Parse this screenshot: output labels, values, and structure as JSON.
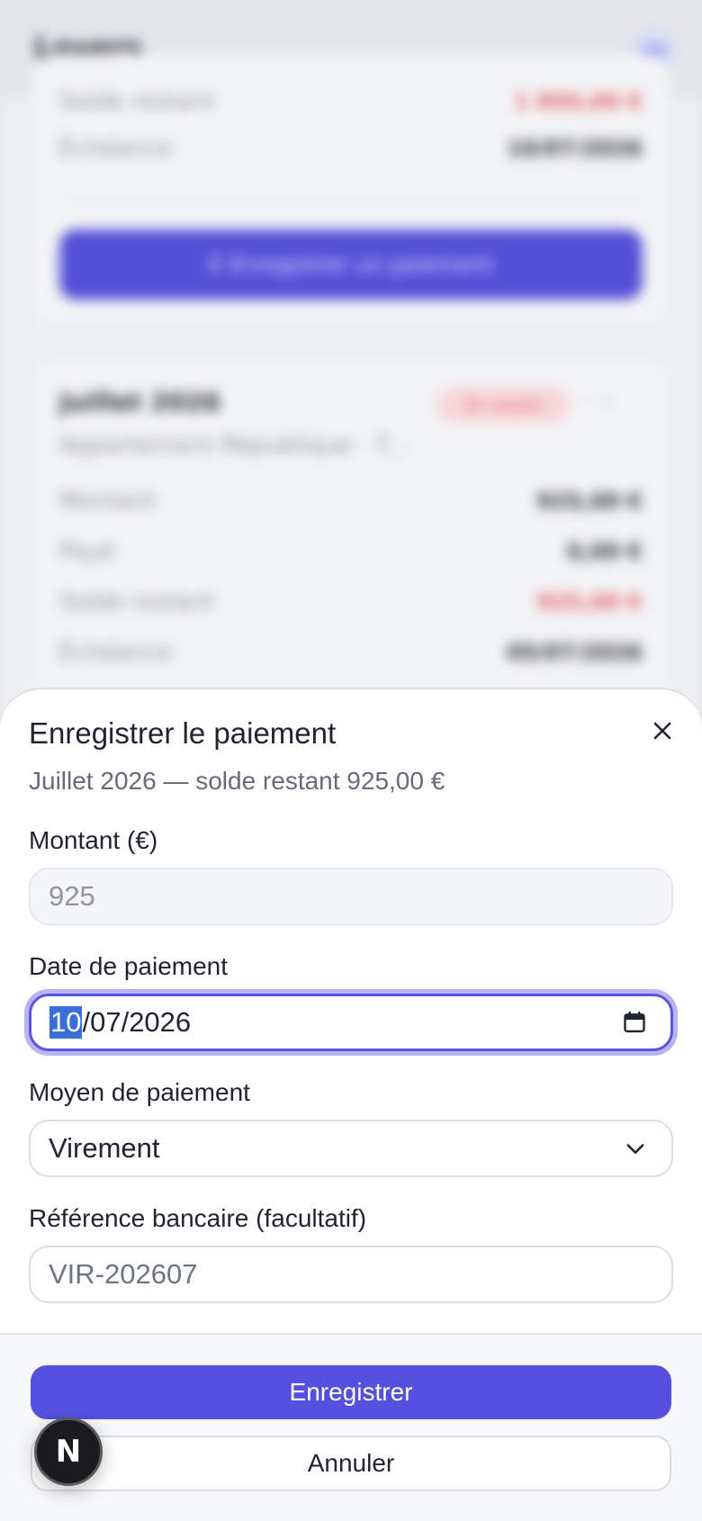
{
  "background": {
    "header_title": "Loyers",
    "avatar_initials": "MD",
    "card1": {
      "rows": [
        {
          "label": "Solde restant",
          "value": "1 850,00 €"
        },
        {
          "label": "Échéance",
          "value": "10/07/2026"
        }
      ],
      "button_label": "€  Enregistrer un paiement"
    },
    "card2": {
      "title": "Juillet 2026",
      "subtitle": "Appartement République · T...",
      "badge": "En retard",
      "rows": [
        {
          "label": "Montant",
          "value": "925,00 €"
        },
        {
          "label": "Payé",
          "value": "0,00 €"
        },
        {
          "label": "Solde restant",
          "value": "925,00 €"
        },
        {
          "label": "Échéance",
          "value": "05/07/2026"
        }
      ]
    }
  },
  "sheet": {
    "title": "Enregistrer le paiement",
    "subtitle": "Juillet 2026 — solde restant 925,00 €",
    "amount": {
      "label": "Montant (€)",
      "value": "925"
    },
    "date": {
      "label": "Date de paiement",
      "day": "10",
      "rest": "/07/2026"
    },
    "method": {
      "label": "Moyen de paiement",
      "value": "Virement"
    },
    "reference": {
      "label": "Référence bancaire (facultatif)",
      "placeholder": "VIR-202607"
    },
    "primary_button": "Enregistrer",
    "secondary_button": "Annuler"
  },
  "dev_badge": "N",
  "colors": {
    "accent": "#5650e0",
    "focus_ring": "#b6b4f2",
    "date_selection": "#3a6fd9",
    "overdue": "#e25a62"
  }
}
